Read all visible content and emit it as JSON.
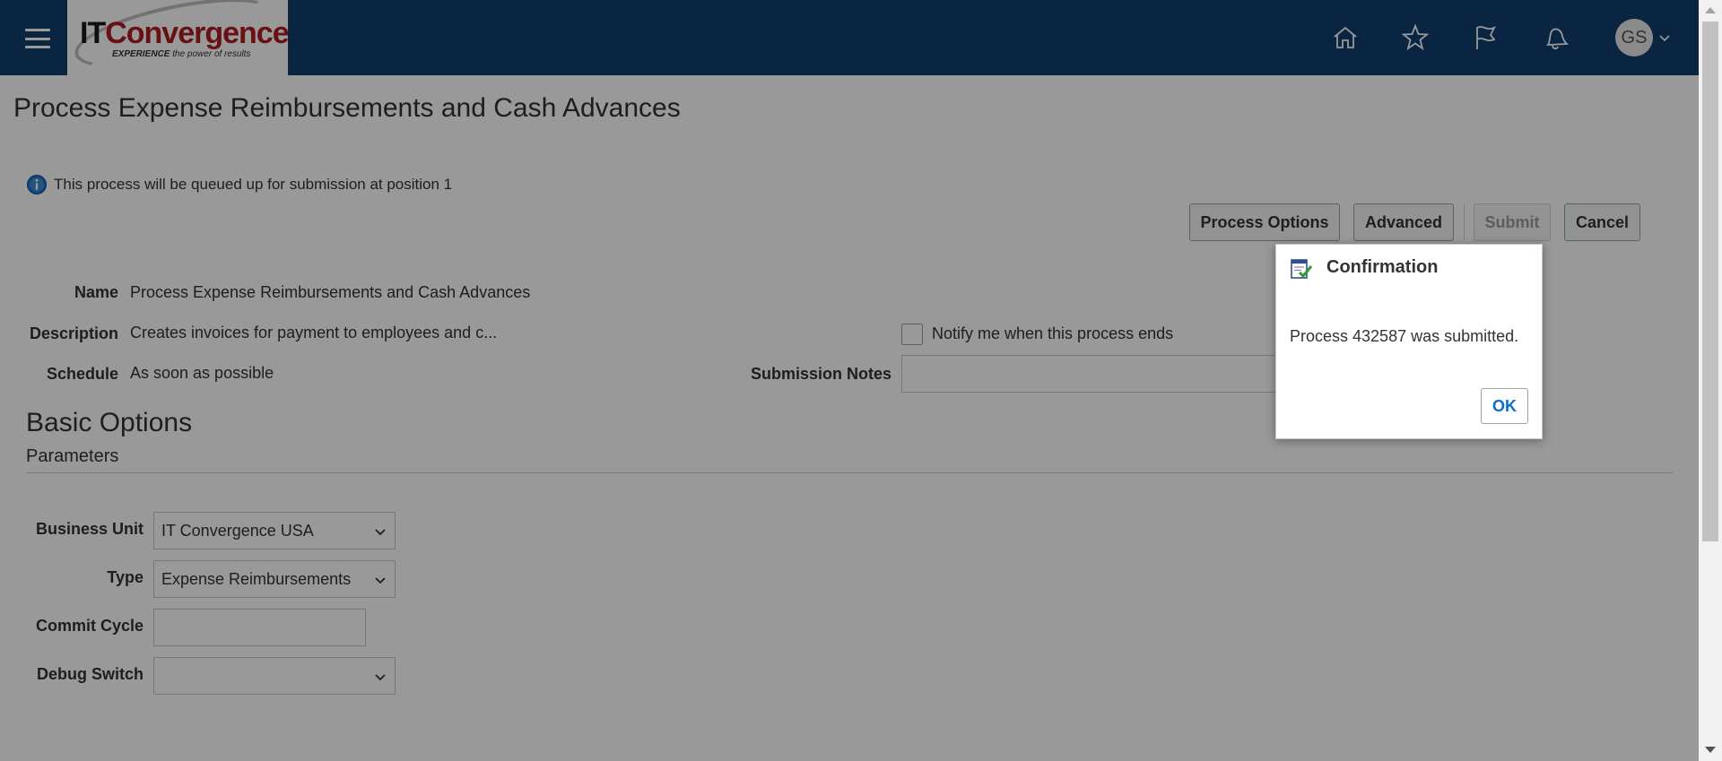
{
  "header": {
    "logo": {
      "brand_it": "IT",
      "brand_rest": "Convergence",
      "tagline_strong": "EXPERIENCE",
      "tagline_rest": " the power of results"
    },
    "icons": [
      "home-icon",
      "star-icon",
      "flag-icon",
      "bell-icon"
    ],
    "user_initials": "GS"
  },
  "page": {
    "title": "Process Expense Reimbursements and Cash Advances",
    "info_message": "This process will be queued up for submission at position 1",
    "buttons": {
      "process_options": "Process Options",
      "advanced": "Advanced",
      "submit": "Submit",
      "cancel": "Cancel"
    },
    "details": {
      "name_label": "Name",
      "name_value": "Process Expense Reimbursements and Cash Advances",
      "description_label": "Description",
      "description_value": "Creates invoices for payment to employees and c...",
      "schedule_label": "Schedule",
      "schedule_value": "As soon as possible",
      "notify_label": "Notify me when this process ends",
      "notify_checked": false,
      "submission_notes_label": "Submission Notes",
      "submission_notes_value": ""
    },
    "basic_options": {
      "title": "Basic Options",
      "subtitle": "Parameters",
      "business_unit_label": "Business Unit",
      "business_unit_value": "IT Convergence USA",
      "type_label": "Type",
      "type_value": "Expense Reimbursements",
      "commit_cycle_label": "Commit Cycle",
      "commit_cycle_value": "",
      "debug_switch_label": "Debug Switch",
      "debug_switch_value": ""
    }
  },
  "dialog": {
    "title": "Confirmation",
    "message": "Process 432587 was submitted.",
    "ok_label": "OK"
  },
  "colors": {
    "header_bg": "#0f3f6f",
    "overlay": "rgba(0,0,0,0.4)",
    "ok_text": "#0a6ed1"
  }
}
